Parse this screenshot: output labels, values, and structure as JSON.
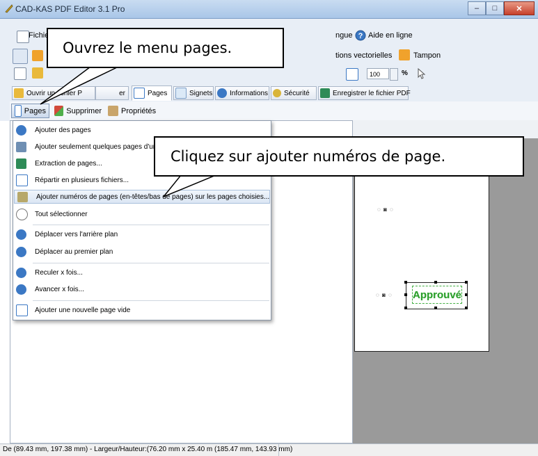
{
  "window": {
    "title": "CAD-KAS PDF Editor 3.1 Pro",
    "minimize": "–",
    "maximize": "□",
    "close": "✕"
  },
  "menu": {
    "file": "Fichie",
    "language": "ngue",
    "help": "Aide en ligne"
  },
  "toolbar": {
    "vector_ops": "tions vectorielles",
    "stamp": "Tampon",
    "zoom_value": "100",
    "zoom_unit": "%"
  },
  "tabs": [
    {
      "label": "Ouvrir un fichier P",
      "icon": "folder-open-icon"
    },
    {
      "label": "er",
      "icon": ""
    },
    {
      "label": "Pages",
      "icon": "pages-icon",
      "active": true
    },
    {
      "label": "Signets",
      "icon": "bookmark-icon"
    },
    {
      "label": "Informations",
      "icon": "info-icon"
    },
    {
      "label": "Sécurité",
      "icon": "key-icon"
    },
    {
      "label": "Enregistrer le fichier PDF",
      "icon": "save-icon"
    }
  ],
  "subtoolbar": {
    "pages": "Pages",
    "delete": "Supprimer",
    "properties": "Propriétés"
  },
  "dropdown": {
    "items": [
      {
        "label": "Ajouter des pages",
        "icon": "add-circle-icon"
      },
      {
        "label": "Ajouter seulement quelques pages d'un",
        "icon": "filter-icon"
      },
      {
        "label": "Extraction de pages...",
        "icon": "extract-icon"
      },
      {
        "label": "Répartir en plusieurs fichiers...",
        "icon": "split-icon"
      },
      {
        "label": "Ajouter numéros de pages (en-têtes/bas de pages) sur les pages choisies...",
        "icon": "number-pages-icon"
      },
      {
        "label": "Tout sélectionner",
        "icon": "lasso-icon"
      },
      {
        "label": "Déplacer vers l'arrière plan",
        "icon": "move-back-icon"
      },
      {
        "label": "Déplacer au premier plan",
        "icon": "move-front-icon"
      },
      {
        "label": "Reculer x fois...",
        "icon": "step-back-icon"
      },
      {
        "label": "Avancer x fois...",
        "icon": "step-forward-icon"
      },
      {
        "label": "Ajouter une nouvelle page vide",
        "icon": "blank-page-icon"
      }
    ]
  },
  "callouts": {
    "menu_tip": "Ouvrez le menu pages.",
    "add_numbers_tip": "Cliquez sur ajouter numéros de page."
  },
  "canvas": {
    "stamp_text": "Approuvé",
    "marker": "◌ ◙ ◌"
  },
  "status": {
    "text": "De (89.43 mm, 197.38 mm) - Largeur/Hauteur:(76.20 mm x 25.40 m (185.47 mm, 143.93 mm)"
  },
  "colors": {
    "accent": "#3b78c4",
    "stamp": "#2c9e2c",
    "title_bar": "#b9d1ec"
  }
}
